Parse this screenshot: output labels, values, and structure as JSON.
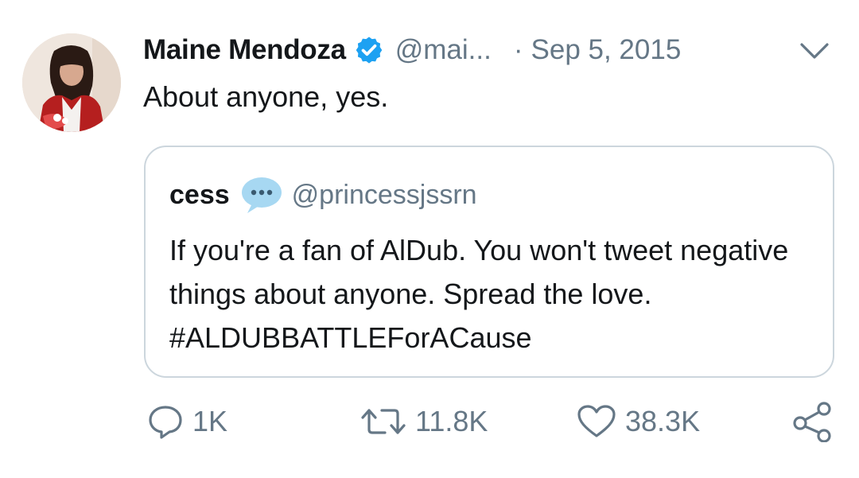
{
  "tweet": {
    "author_name": "Maine Mendoza",
    "author_handle": "@mai...",
    "separator": "·",
    "date": "Sep 5, 2015",
    "text": "About anyone, yes.",
    "verified": true
  },
  "quoted": {
    "author_name": "cess",
    "author_handle": "@princessjssrn",
    "text": "If you're a fan of AlDub. You won't tweet negative things about anyone. Spread the love.  #ALDUBBATTLEForACause",
    "emoji": "speech-balloon"
  },
  "actions": {
    "reply_count": "1K",
    "retweet_count": "11.8K",
    "like_count": "38.3K"
  },
  "colors": {
    "text": "#14171a",
    "secondary": "#657786",
    "verified_blue": "#1da1f2",
    "border": "#ccd6dd"
  },
  "icons": [
    "verified-badge-icon",
    "chevron-down-icon",
    "speech-balloon-icon",
    "reply-icon",
    "retweet-icon",
    "like-icon",
    "share-icon"
  ]
}
